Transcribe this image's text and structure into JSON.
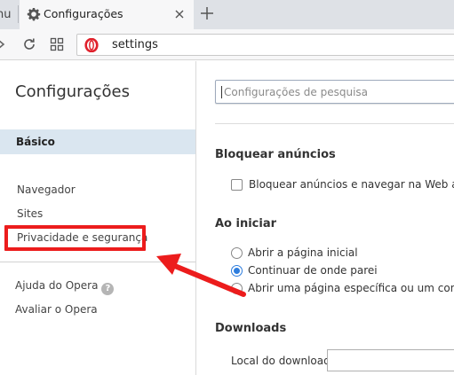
{
  "tabbar": {
    "prev_tab_fragment": "nu",
    "active_tab_title": "Configurações"
  },
  "addressbar": {
    "url": "settings"
  },
  "sidebar": {
    "title": "Configurações",
    "selected_item": "Básico",
    "items": [
      {
        "label": "Navegador"
      },
      {
        "label": "Sites"
      },
      {
        "label": "Privacidade e segurança"
      }
    ],
    "footer_items": [
      {
        "label": "Ajuda do Opera"
      },
      {
        "label": "Avaliar o Opera"
      }
    ]
  },
  "main": {
    "search_placeholder": "Configurações de pesquisa",
    "sections": {
      "adblock": {
        "title": "Bloquear anúncios",
        "checkbox_label": "Bloquear anúncios e navegar na Web até três vezes mais rápido",
        "checked": false
      },
      "startup": {
        "title": "Ao iniciar",
        "options": [
          {
            "label": "Abrir a página inicial",
            "selected": false
          },
          {
            "label": "Continuar de onde parei",
            "selected": true
          },
          {
            "label": "Abrir uma página específica ou um conjunto de páginas",
            "selected": false
          }
        ]
      },
      "downloads": {
        "title": "Downloads",
        "location_label": "Local do download:",
        "location_value": ""
      }
    }
  },
  "annotation": {
    "highlight_color": "#ec1c1c",
    "highlight_target": "Privacidade e segurança"
  },
  "colors": {
    "accent": "#2d7ddd",
    "selected_bg": "#dae6f0",
    "opera_red": "#e0202b"
  }
}
